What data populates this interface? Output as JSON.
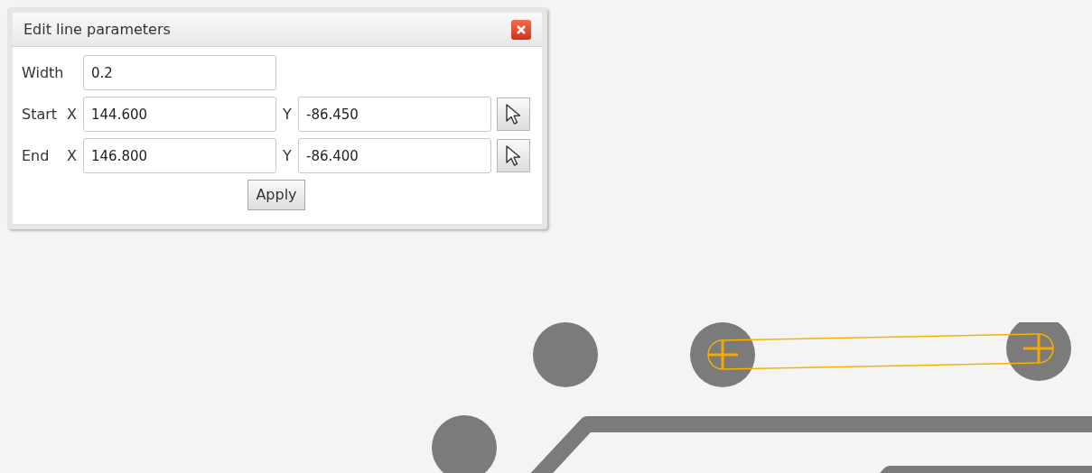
{
  "dialog": {
    "title": "Edit line parameters",
    "rows": [
      {
        "kind": "single",
        "label": "Width",
        "value": "0.2"
      },
      {
        "kind": "point",
        "label": "Start",
        "x_label": "X",
        "x_value": "144.600",
        "y_label": "Y",
        "y_value": "-86.450"
      },
      {
        "kind": "point",
        "label": "End",
        "x_label": "X",
        "x_value": "146.800",
        "y_label": "Y",
        "y_value": "-86.400"
      }
    ],
    "apply_button": "Apply"
  }
}
